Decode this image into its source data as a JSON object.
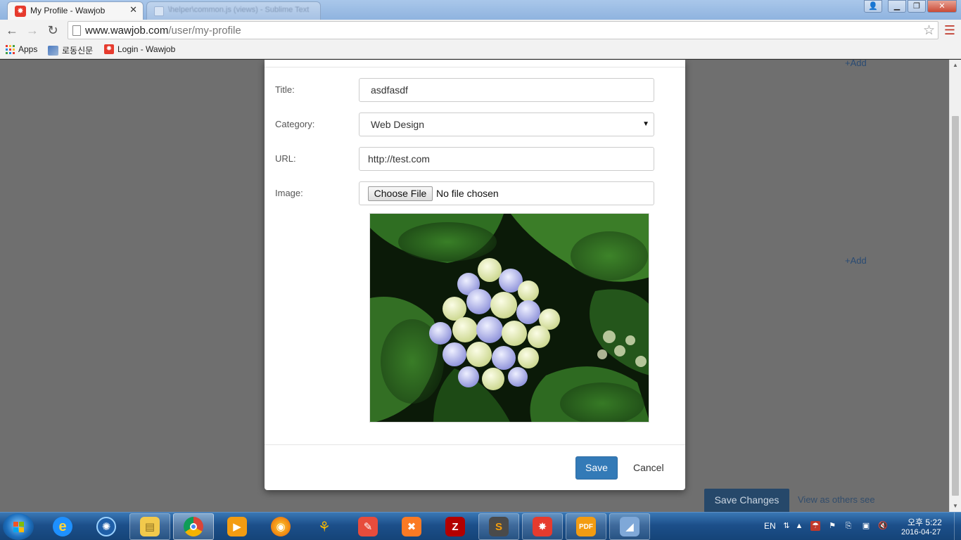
{
  "browser": {
    "active_tab": {
      "title": "My Profile - Wawjob",
      "favicon": "wawjob-icon"
    },
    "inactive_tab": {
      "title": "\\helper\\common.js (views) - Sublime Text"
    },
    "address": {
      "domain": "www.wawjob.com",
      "path": "/user/my-profile"
    },
    "bookmarks": [
      {
        "label": "Apps",
        "icon": "apps-grid-icon"
      },
      {
        "label": "로동신문",
        "icon": "news-icon"
      },
      {
        "label": "Login - Wawjob",
        "icon": "wawjob-icon"
      }
    ]
  },
  "background_page": {
    "add_links": [
      "+Add",
      "+Add"
    ],
    "save_changes": "Save Changes",
    "view_as_others": "View as others see"
  },
  "modal": {
    "fields": {
      "title": {
        "label": "Title:",
        "value": "asdfasdf"
      },
      "category": {
        "label": "Category:",
        "value": "Web Design"
      },
      "url": {
        "label": "URL:",
        "value": "http://test.com"
      },
      "image": {
        "label": "Image:",
        "button": "Choose File",
        "status": "No file chosen"
      }
    },
    "preview_image": "hydrangea-flower-photo",
    "save_label": "Save",
    "cancel_label": "Cancel"
  },
  "taskbar": {
    "items": [
      "start-button",
      "internet-explorer",
      "media-center",
      "file-explorer",
      "chrome",
      "media-player",
      "firefox",
      "app-butterfly",
      "paint-tool",
      "xampp",
      "filezilla",
      "sublime-text",
      "wawjob",
      "pdf-tool",
      "dolphin-app"
    ],
    "language": "EN",
    "time": "오후 5:22",
    "date": "2016-04-27"
  },
  "colors": {
    "primary": "#337ab7",
    "overlay": "#6f6f6f",
    "taskbar": "#1c4f8a"
  }
}
